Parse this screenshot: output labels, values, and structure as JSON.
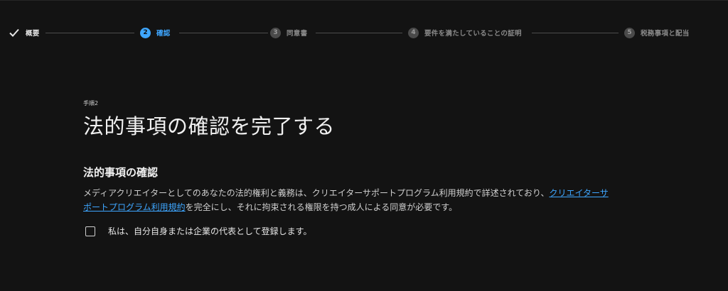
{
  "stepper": {
    "steps": [
      {
        "label": "概要",
        "state": "done"
      },
      {
        "number": "2",
        "label": "確認",
        "state": "active"
      },
      {
        "number": "3",
        "label": "同意書",
        "state": "pending"
      },
      {
        "number": "4",
        "label": "要件を満たしていることの証明",
        "state": "pending"
      },
      {
        "number": "5",
        "label": "税務事項と配当",
        "state": "pending"
      }
    ],
    "colors": {
      "active": "#3ea6ff",
      "pending": "#4a4a4a",
      "done": "#e6e6e6"
    }
  },
  "main": {
    "step_number": "手順2",
    "title": "法的事項の確認を完了する",
    "section_title": "法的事項の確認",
    "description_before": "メディアクリエイターとしてのあなたの法的権利と義務は、クリエイターサポートプログラム利用規約で詳述されており、",
    "description_link": "クリエイターサポートプログラム利用規約",
    "description_after": "を完全にし、それに拘束される権限を持つ成人による同意が必要です。",
    "checkbox_label": "私は、自分自身または企業の代表として登録します。",
    "checkbox_checked": false
  }
}
